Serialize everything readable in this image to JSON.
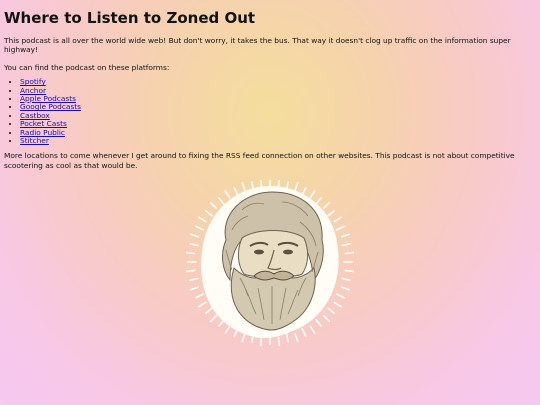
{
  "page": {
    "title": "Where to Listen to Zoned Out",
    "intro": "This podcast is all over the world wide web! But don't worry, it takes the bus. That way it doesn't clog up traffic on the information super highway!",
    "platforms_intro": "You can find the podcast on these platforms:",
    "platforms": [
      "Spotify",
      "Anchor",
      "Apple Podcasts",
      "Google Podcasts",
      "Castbox",
      "Pocket Casts",
      "Radio Public",
      "Stitcher"
    ],
    "more_text": "More locations to come whenever I get around to fixing the RSS feed connection on other websites. This podcast is not about competitive scootering as cool as that would be."
  },
  "colors": {
    "link": "#1a0dab",
    "background_center": "#f4de9c",
    "background_edge": "#f6c8f2"
  },
  "image": {
    "name": "bearded-man-portrait-illustration"
  }
}
